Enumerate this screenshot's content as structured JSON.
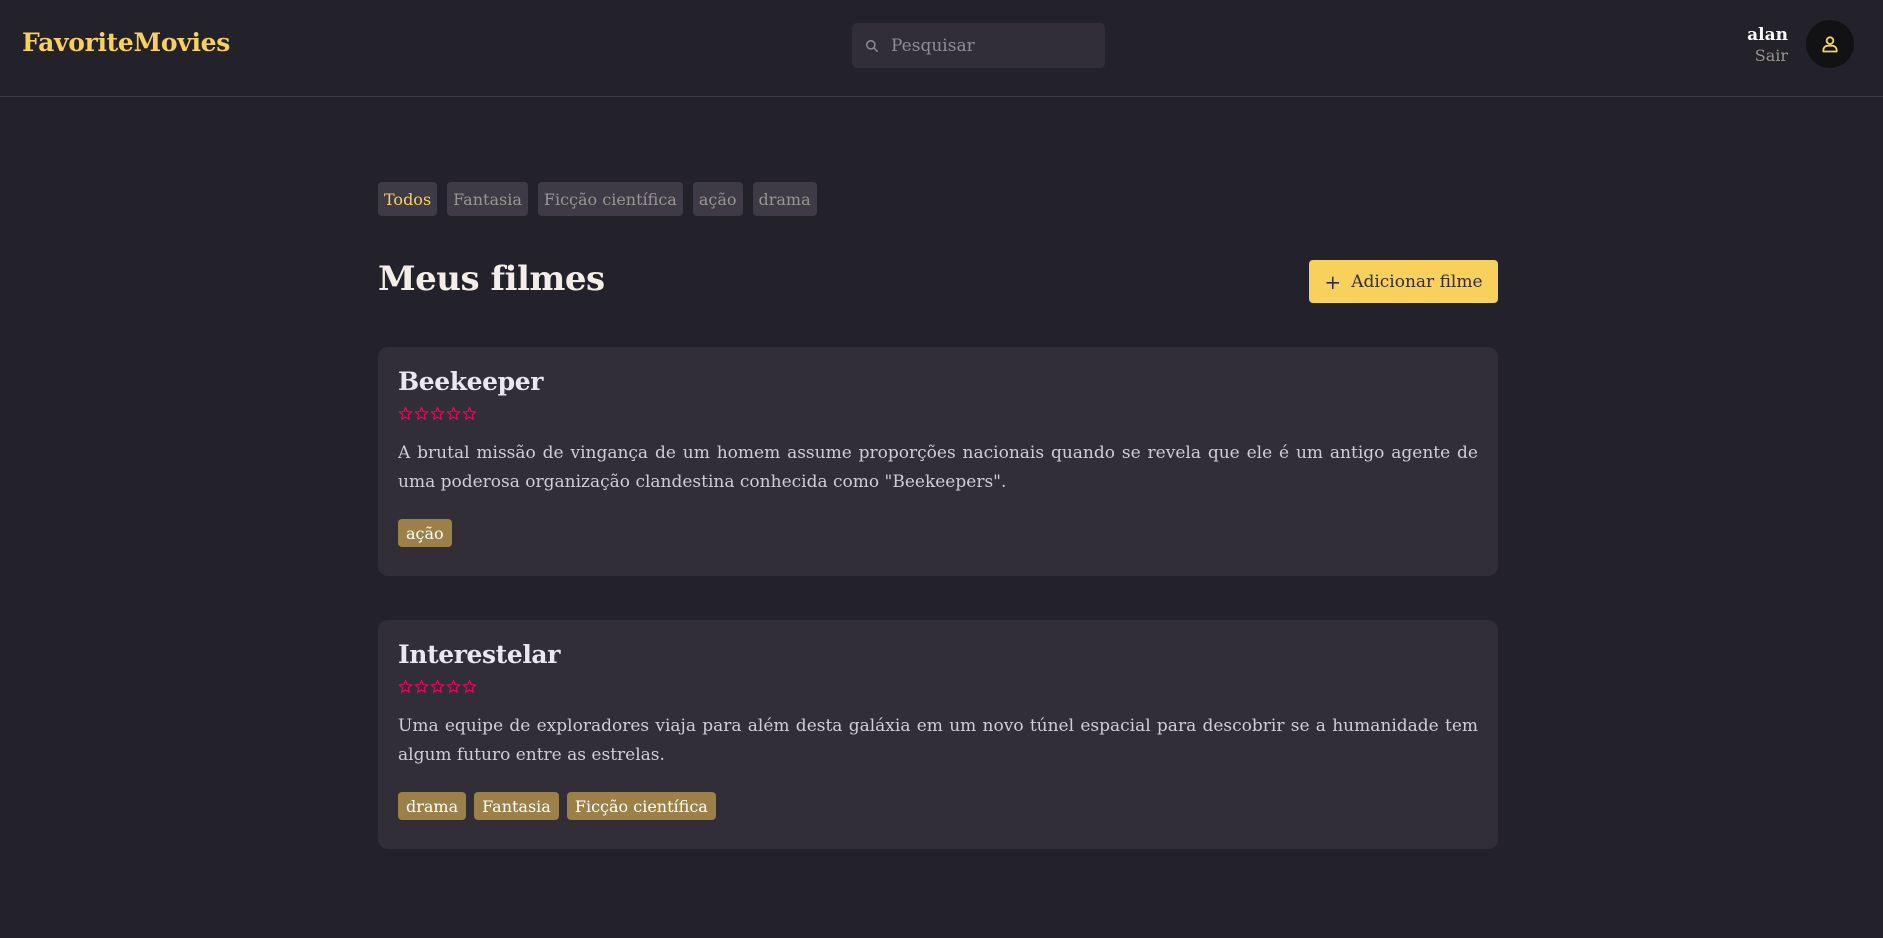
{
  "header": {
    "brand": "FavoriteMovies",
    "search_placeholder": "Pesquisar",
    "user_name": "alan",
    "logout_label": "Sair"
  },
  "filters": [
    "Todos",
    "Fantasia",
    "Ficção científica",
    "ação",
    "drama"
  ],
  "active_filter": "Todos",
  "page_title": "Meus filmes",
  "add_button_label": "Adicionar filme",
  "movies": [
    {
      "title": "Beekeeper",
      "rating": 0,
      "description": "A brutal missão de vingança de um homem assume proporções nacionais quando se revela que ele é um antigo agente de uma poderosa organização clandestina conhecida como \"Beekeepers\".",
      "tags": [
        "ação"
      ]
    },
    {
      "title": "Interestelar",
      "rating": 0,
      "description": "Uma equipe de exploradores viaja para além desta galáxia em um novo túnel espacial para descobrir se a humanidade tem algum futuro entre as estrelas.",
      "tags": [
        "drama",
        "Fantasia",
        "Ficção científica"
      ]
    }
  ],
  "colors": {
    "background": "#232129",
    "accent": "#f7d15c",
    "card": "#312e38",
    "tag": "#9b804a",
    "star": "#ff005c"
  }
}
